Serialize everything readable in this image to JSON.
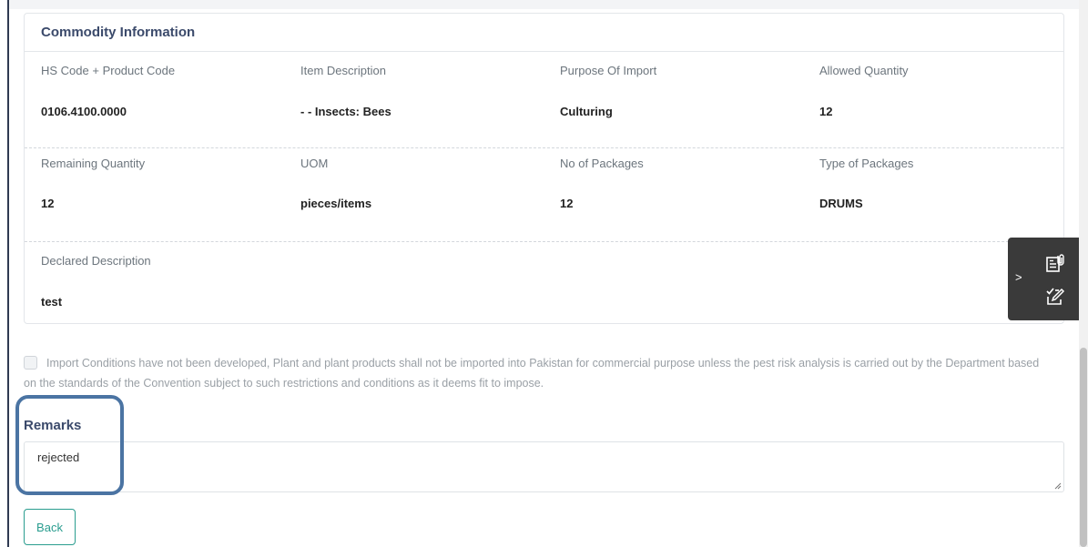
{
  "card": {
    "title": "Commodity Information",
    "rows": [
      [
        {
          "label": "HS Code + Product Code",
          "value": "0106.4100.0000"
        },
        {
          "label": "Item Description",
          "value": "- - Insects: Bees"
        },
        {
          "label": "Purpose Of Import",
          "value": "Culturing"
        },
        {
          "label": "Allowed Quantity",
          "value": "12"
        }
      ],
      [
        {
          "label": "Remaining Quantity",
          "value": "12"
        },
        {
          "label": "UOM",
          "value": "pieces/items"
        },
        {
          "label": "No of Packages",
          "value": "12"
        },
        {
          "label": "Type of Packages",
          "value": "DRUMS"
        }
      ],
      [
        {
          "label": "Declared Description",
          "value": "test"
        }
      ]
    ]
  },
  "float_panel": {
    "chevron": ">",
    "icons": [
      "document-attachment-icon",
      "edit-checklist-icon"
    ]
  },
  "condition": {
    "checked": false,
    "text": "Import Conditions have not been developed, Plant and plant products shall not be imported into Pakistan for commercial purpose unless the pest risk analysis is carried out by the Department based on the standards of the Convention subject to such restrictions and conditions as it deems fit to impose."
  },
  "remarks": {
    "label": "Remarks",
    "value": "rejected"
  },
  "buttons": {
    "back": "Back"
  },
  "colors": {
    "heading": "#3b4a6b",
    "accent": "#2a9d8f",
    "highlight": "#4b74a3",
    "panel": "#3a3a3a"
  }
}
